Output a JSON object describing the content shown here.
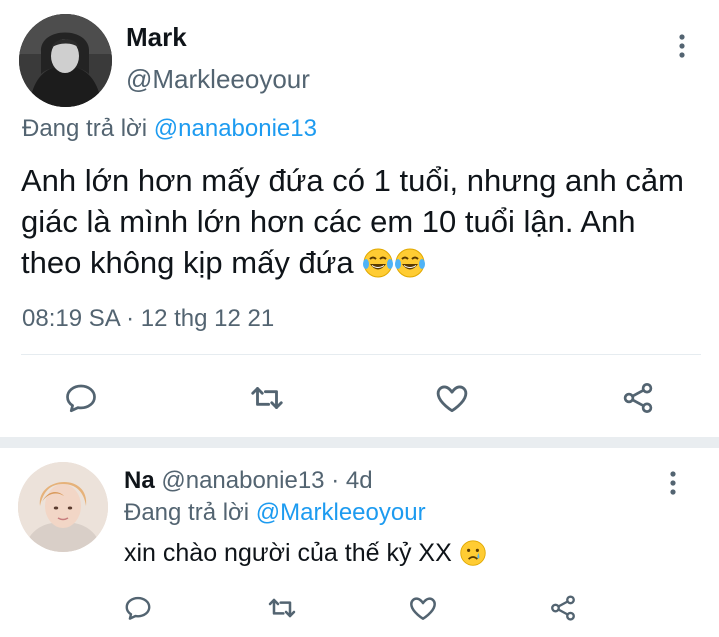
{
  "main_tweet": {
    "author_name": "Mark",
    "author_handle": "@Markleeoyour",
    "reply_prefix": "Đang trả lời",
    "reply_mention": "@nanabonie13",
    "text": "Anh lớn hơn mấy đứa có 1 tuổi, nhưng anh cảm giác là mình lớn hơn các em 10 tuổi lận. Anh theo không kịp mấy đứa",
    "emojis": [
      "tears-of-joy",
      "tears-of-joy"
    ],
    "timestamp": "08:19 SA · 12 thg 12 21",
    "actions": [
      "reply-icon",
      "retweet-icon",
      "like-icon",
      "share-icon"
    ]
  },
  "reply_tweet": {
    "author_name": "Na",
    "author_handle": "@nanabonie13",
    "dot": "·",
    "time": "4d",
    "reply_prefix": "Đang trả lời",
    "reply_mention": "@Markleeoyour",
    "text": "xin chào người của thế kỷ XX",
    "emoji": "crying-face",
    "actions": [
      "reply-icon",
      "retweet-icon",
      "like-icon",
      "share-icon"
    ]
  },
  "colors": {
    "primary_text": "#0f1419",
    "secondary_text": "#536471",
    "link": "#1d9bf0",
    "divider": "#e6ecf0",
    "separator": "#e9edf0"
  }
}
